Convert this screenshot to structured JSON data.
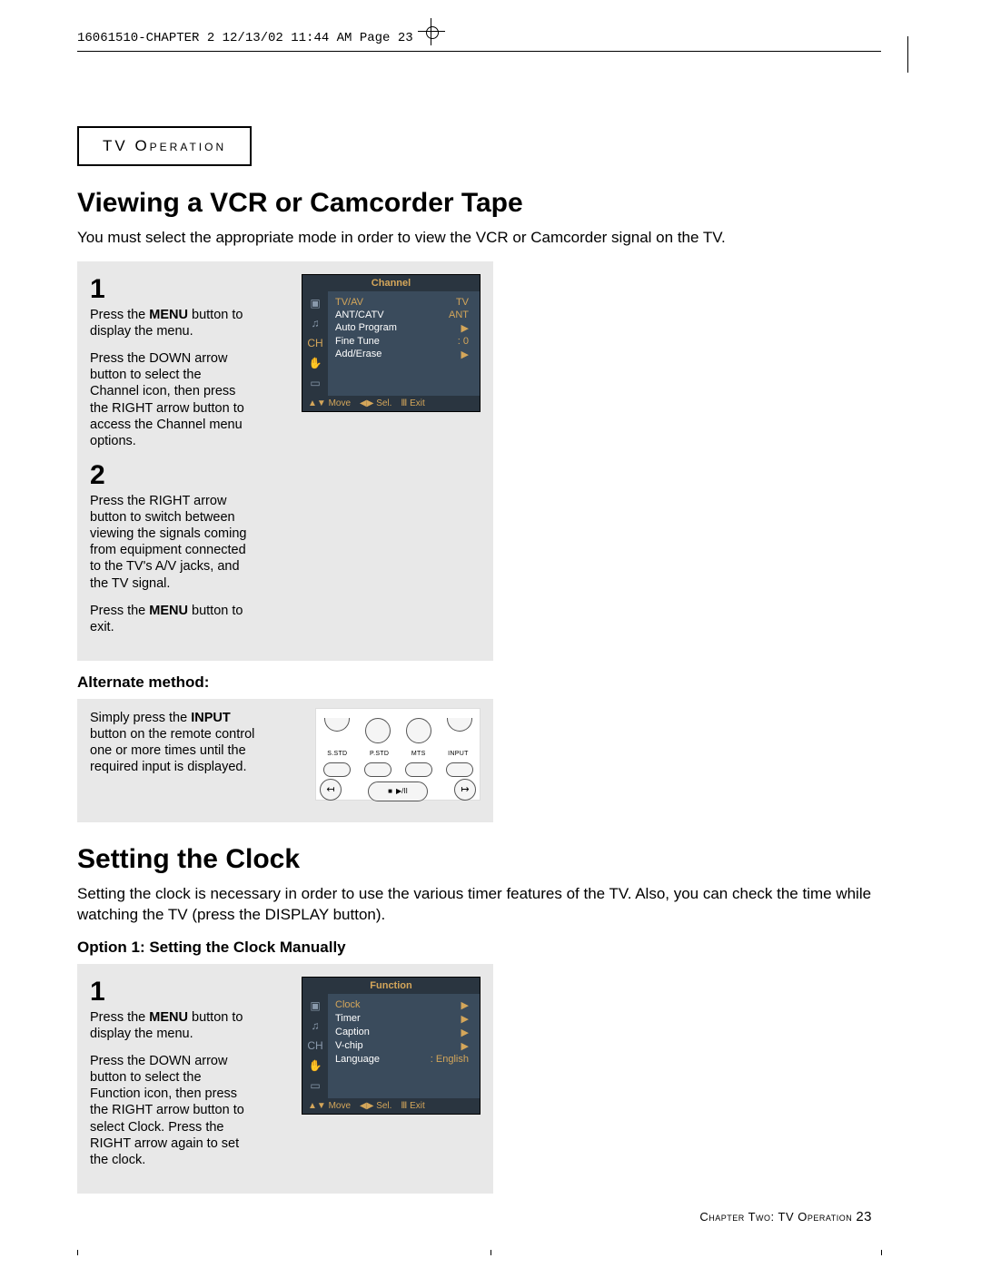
{
  "header": "16061510-CHAPTER 2  12/13/02 11:44 AM  Page 23",
  "section_tab": "TV Operation",
  "section1": {
    "title": "Viewing a VCR or Camcorder Tape",
    "intro": "You must select the appropriate mode in order to view the VCR or Camcorder signal on the TV.",
    "step1num": "1",
    "step1a_pre": "Press the ",
    "step1a_bold": "MENU",
    "step1a_post": " button to display the menu.",
    "step1b": "Press the DOWN  arrow button to select the Channel icon, then press the RIGHT arrow button to access the Channel menu options.",
    "step2num": "2",
    "step2a": "Press the RIGHT arrow button to switch between viewing the signals coming from equipment connected to the TV's A/V jacks, and the TV signal.",
    "step2b_pre": "Press the ",
    "step2b_bold": "MENU",
    "step2b_post": " button to exit.",
    "alt_head": "Alternate method:",
    "alt_pre": "Simply press the ",
    "alt_bold": "INPUT",
    "alt_post": " button on the remote control one or more times until the required input is displayed."
  },
  "osd1": {
    "title": "Channel",
    "rows": [
      {
        "label": "TV/AV",
        "val": "TV"
      },
      {
        "label": "ANT/CATV",
        "val": "ANT"
      },
      {
        "label": "Auto Program",
        "val": "▶"
      },
      {
        "label": "Fine Tune",
        "val": ":  0"
      },
      {
        "label": "Add/Erase",
        "val": "▶"
      }
    ],
    "footer": {
      "move": "▲▼ Move",
      "sel": "◀▶ Sel.",
      "exit": "Ⅲ Exit"
    }
  },
  "remote": {
    "labels": [
      "S.STD",
      "P.STD",
      "MTS",
      "INPUT"
    ]
  },
  "section2": {
    "title": "Setting the Clock",
    "intro": "Setting the clock is necessary in order to use the various timer features of the TV. Also, you can check the time while watching the TV (press the DISPLAY button).",
    "opt": "Option 1: Setting the Clock Manually",
    "step1num": "1",
    "step1a_pre": "Press the ",
    "step1a_bold": "MENU",
    "step1a_post": " button to display the menu.",
    "step1b": "Press the DOWN  arrow button to select the Function icon, then press the RIGHT arrow button to select Clock. Press the RIGHT arrow again to set the clock."
  },
  "osd2": {
    "title": "Function",
    "rows": [
      {
        "label": "Clock",
        "val": "▶"
      },
      {
        "label": "Timer",
        "val": "▶"
      },
      {
        "label": "Caption",
        "val": "▶"
      },
      {
        "label": "V-chip",
        "val": "▶"
      },
      {
        "label": "Language",
        "val": ": English"
      }
    ],
    "footer": {
      "move": "▲▼ Move",
      "sel": "◀▶ Sel.",
      "exit": "Ⅲ Exit"
    }
  },
  "footer": {
    "text": "Chapter Two: TV Operation ",
    "page": "23"
  }
}
